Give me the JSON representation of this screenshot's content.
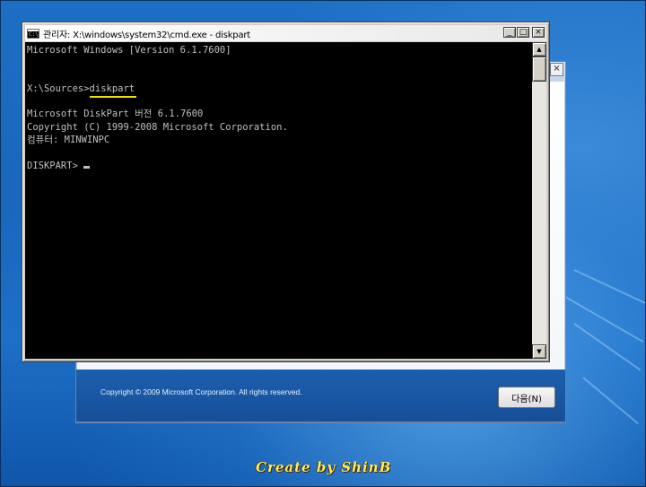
{
  "cmd_window": {
    "title": "관리자: X:\\windows\\system32\\cmd.exe - diskpart",
    "icon": "console-icon",
    "controls": {
      "minimize": "_",
      "maximize": "□",
      "close": "×"
    },
    "console": {
      "lines": [
        "Microsoft Windows [Version 6.1.7600]",
        "",
        "",
        "X:\\Sources>",
        "",
        "Microsoft DiskPart 버전 6.1.7600",
        "Copyright (C) 1999-2008 Microsoft Corporation.",
        "컴퓨터: MINWINPC",
        "",
        "DISKPART> "
      ],
      "typed_command": "diskpart",
      "highlight_color": "#f0e000"
    },
    "scrollbar": {
      "up": "▲",
      "down": "▼"
    }
  },
  "setup_window": {
    "close": "×",
    "copyright": "Copyright © 2009 Microsoft Corporation. All rights reserved.",
    "next_button": "다음(N)"
  },
  "watermark": "Create  by  ShinB",
  "colors": {
    "console_bg": "#000000",
    "console_text": "#c0c0c0",
    "desktop_blue": "#1a73c9",
    "watermark": "#ffe96a"
  }
}
